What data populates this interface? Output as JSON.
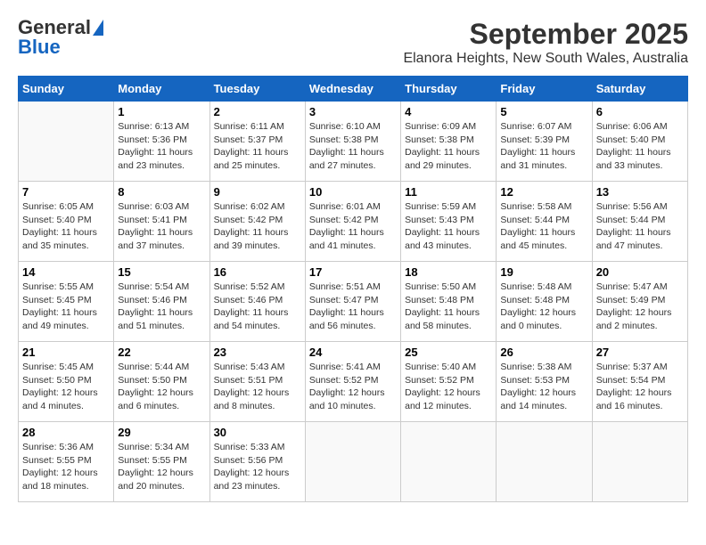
{
  "logo": {
    "general": "General",
    "blue": "Blue"
  },
  "title": "September 2025",
  "subtitle": "Elanora Heights, New South Wales, Australia",
  "days": [
    "Sunday",
    "Monday",
    "Tuesday",
    "Wednesday",
    "Thursday",
    "Friday",
    "Saturday"
  ],
  "weeks": [
    [
      {
        "day": "",
        "info": ""
      },
      {
        "day": "1",
        "info": "Sunrise: 6:13 AM\nSunset: 5:36 PM\nDaylight: 11 hours\nand 23 minutes."
      },
      {
        "day": "2",
        "info": "Sunrise: 6:11 AM\nSunset: 5:37 PM\nDaylight: 11 hours\nand 25 minutes."
      },
      {
        "day": "3",
        "info": "Sunrise: 6:10 AM\nSunset: 5:38 PM\nDaylight: 11 hours\nand 27 minutes."
      },
      {
        "day": "4",
        "info": "Sunrise: 6:09 AM\nSunset: 5:38 PM\nDaylight: 11 hours\nand 29 minutes."
      },
      {
        "day": "5",
        "info": "Sunrise: 6:07 AM\nSunset: 5:39 PM\nDaylight: 11 hours\nand 31 minutes."
      },
      {
        "day": "6",
        "info": "Sunrise: 6:06 AM\nSunset: 5:40 PM\nDaylight: 11 hours\nand 33 minutes."
      }
    ],
    [
      {
        "day": "7",
        "info": "Sunrise: 6:05 AM\nSunset: 5:40 PM\nDaylight: 11 hours\nand 35 minutes."
      },
      {
        "day": "8",
        "info": "Sunrise: 6:03 AM\nSunset: 5:41 PM\nDaylight: 11 hours\nand 37 minutes."
      },
      {
        "day": "9",
        "info": "Sunrise: 6:02 AM\nSunset: 5:42 PM\nDaylight: 11 hours\nand 39 minutes."
      },
      {
        "day": "10",
        "info": "Sunrise: 6:01 AM\nSunset: 5:42 PM\nDaylight: 11 hours\nand 41 minutes."
      },
      {
        "day": "11",
        "info": "Sunrise: 5:59 AM\nSunset: 5:43 PM\nDaylight: 11 hours\nand 43 minutes."
      },
      {
        "day": "12",
        "info": "Sunrise: 5:58 AM\nSunset: 5:44 PM\nDaylight: 11 hours\nand 45 minutes."
      },
      {
        "day": "13",
        "info": "Sunrise: 5:56 AM\nSunset: 5:44 PM\nDaylight: 11 hours\nand 47 minutes."
      }
    ],
    [
      {
        "day": "14",
        "info": "Sunrise: 5:55 AM\nSunset: 5:45 PM\nDaylight: 11 hours\nand 49 minutes."
      },
      {
        "day": "15",
        "info": "Sunrise: 5:54 AM\nSunset: 5:46 PM\nDaylight: 11 hours\nand 51 minutes."
      },
      {
        "day": "16",
        "info": "Sunrise: 5:52 AM\nSunset: 5:46 PM\nDaylight: 11 hours\nand 54 minutes."
      },
      {
        "day": "17",
        "info": "Sunrise: 5:51 AM\nSunset: 5:47 PM\nDaylight: 11 hours\nand 56 minutes."
      },
      {
        "day": "18",
        "info": "Sunrise: 5:50 AM\nSunset: 5:48 PM\nDaylight: 11 hours\nand 58 minutes."
      },
      {
        "day": "19",
        "info": "Sunrise: 5:48 AM\nSunset: 5:48 PM\nDaylight: 12 hours\nand 0 minutes."
      },
      {
        "day": "20",
        "info": "Sunrise: 5:47 AM\nSunset: 5:49 PM\nDaylight: 12 hours\nand 2 minutes."
      }
    ],
    [
      {
        "day": "21",
        "info": "Sunrise: 5:45 AM\nSunset: 5:50 PM\nDaylight: 12 hours\nand 4 minutes."
      },
      {
        "day": "22",
        "info": "Sunrise: 5:44 AM\nSunset: 5:50 PM\nDaylight: 12 hours\nand 6 minutes."
      },
      {
        "day": "23",
        "info": "Sunrise: 5:43 AM\nSunset: 5:51 PM\nDaylight: 12 hours\nand 8 minutes."
      },
      {
        "day": "24",
        "info": "Sunrise: 5:41 AM\nSunset: 5:52 PM\nDaylight: 12 hours\nand 10 minutes."
      },
      {
        "day": "25",
        "info": "Sunrise: 5:40 AM\nSunset: 5:52 PM\nDaylight: 12 hours\nand 12 minutes."
      },
      {
        "day": "26",
        "info": "Sunrise: 5:38 AM\nSunset: 5:53 PM\nDaylight: 12 hours\nand 14 minutes."
      },
      {
        "day": "27",
        "info": "Sunrise: 5:37 AM\nSunset: 5:54 PM\nDaylight: 12 hours\nand 16 minutes."
      }
    ],
    [
      {
        "day": "28",
        "info": "Sunrise: 5:36 AM\nSunset: 5:55 PM\nDaylight: 12 hours\nand 18 minutes."
      },
      {
        "day": "29",
        "info": "Sunrise: 5:34 AM\nSunset: 5:55 PM\nDaylight: 12 hours\nand 20 minutes."
      },
      {
        "day": "30",
        "info": "Sunrise: 5:33 AM\nSunset: 5:56 PM\nDaylight: 12 hours\nand 23 minutes."
      },
      {
        "day": "",
        "info": ""
      },
      {
        "day": "",
        "info": ""
      },
      {
        "day": "",
        "info": ""
      },
      {
        "day": "",
        "info": ""
      }
    ]
  ]
}
